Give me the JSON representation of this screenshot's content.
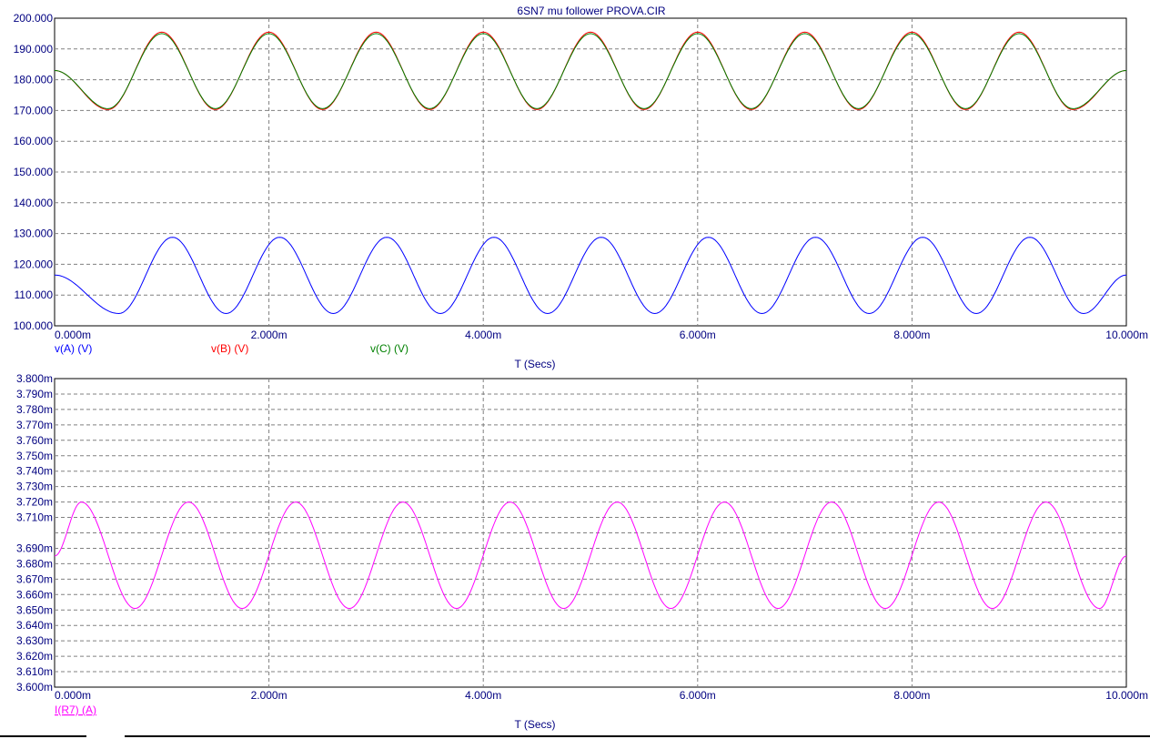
{
  "title": "6SN7  mu follower PROVA.CIR",
  "colors": {
    "frame": "#000000",
    "grid": "#808080",
    "axis_text": "#000080",
    "trace_A": "#0000ff",
    "trace_B": "#ff0000",
    "trace_C": "#008000",
    "trace_I": "#ff00ff"
  },
  "chart_data": [
    {
      "type": "line",
      "title": "6SN7  mu follower PROVA.CIR",
      "xlabel": "T (Secs)",
      "xlim": [
        0,
        10
      ],
      "x_unit": "ms",
      "x_ticks": [
        "0.000m",
        "2.000m",
        "4.000m",
        "6.000m",
        "8.000m",
        "10.000m"
      ],
      "ylim": [
        100,
        200
      ],
      "y_ticks": [
        "200.000",
        "190.000",
        "180.000",
        "170.000",
        "160.000",
        "150.000",
        "140.000",
        "130.000",
        "120.000",
        "110.000",
        "100.000"
      ],
      "grid": true,
      "series": [
        {
          "name": "v(A) (V)",
          "color": "#0000ff",
          "x": [
            0,
            0.6,
            1.1,
            1.6,
            2.1,
            2.6,
            3.1,
            3.6,
            4.1,
            4.6,
            5.1,
            5.6,
            6.1,
            6.6,
            7.1,
            7.6,
            8.1,
            8.6,
            9.1,
            9.6,
            10
          ],
          "values": [
            116.5,
            104,
            128.8,
            104,
            128.8,
            104,
            128.8,
            104,
            128.8,
            104,
            128.8,
            104,
            128.8,
            104,
            128.8,
            104,
            128.8,
            104,
            128.8,
            104,
            116.5
          ]
        },
        {
          "name": "v(B) (V)",
          "color": "#ff0000",
          "x": [
            0,
            0.5,
            1.0,
            1.5,
            2.0,
            2.5,
            3.0,
            3.5,
            4.0,
            4.5,
            5.0,
            5.5,
            6.0,
            6.5,
            7.0,
            7.5,
            8.0,
            8.5,
            9.0,
            9.5,
            10
          ],
          "values": [
            183,
            170.3,
            195.5,
            170.3,
            195.5,
            170.3,
            195.5,
            170.3,
            195.5,
            170.3,
            195.5,
            170.3,
            195.5,
            170.3,
            195.5,
            170.3,
            195.5,
            170.3,
            195.5,
            170.3,
            183
          ]
        },
        {
          "name": "v(C) (V)",
          "color": "#008000",
          "x": [
            0,
            0.5,
            1.0,
            1.5,
            2.0,
            2.5,
            3.0,
            3.5,
            4.0,
            4.5,
            5.0,
            5.5,
            6.0,
            6.5,
            7.0,
            7.5,
            8.0,
            8.5,
            9.0,
            9.5,
            10
          ],
          "values": [
            183,
            170.6,
            195.0,
            170.6,
            195.0,
            170.6,
            195.0,
            170.6,
            195.0,
            170.6,
            195.0,
            170.6,
            195.0,
            170.6,
            195.0,
            170.6,
            195.0,
            170.6,
            195.0,
            170.6,
            183
          ]
        }
      ]
    },
    {
      "type": "line",
      "xlabel": "T (Secs)",
      "xlim": [
        0,
        10
      ],
      "x_unit": "ms",
      "x_ticks": [
        "0.000m",
        "2.000m",
        "4.000m",
        "6.000m",
        "8.000m",
        "10.000m"
      ],
      "ylim": [
        3.6,
        3.8
      ],
      "y_ticks": [
        "3.800m",
        "3.790m",
        "3.780m",
        "3.770m",
        "3.760m",
        "3.750m",
        "3.740m",
        "3.730m",
        "3.720m",
        "3.710m",
        "",
        "3.690m",
        "3.680m",
        "3.670m",
        "3.660m",
        "3.650m",
        "3.640m",
        "3.630m",
        "3.620m",
        "3.610m",
        "3.600m"
      ],
      "grid": true,
      "series": [
        {
          "name": "I(R7) (A)",
          "color": "#ff00ff",
          "x": [
            0,
            0.25,
            0.75,
            1.25,
            1.75,
            2.25,
            2.75,
            3.25,
            3.75,
            4.25,
            4.75,
            5.25,
            5.75,
            6.25,
            6.75,
            7.25,
            7.75,
            8.25,
            8.75,
            9.25,
            9.75,
            10
          ],
          "values": [
            3.685,
            3.72,
            3.651,
            3.72,
            3.651,
            3.72,
            3.651,
            3.72,
            3.651,
            3.72,
            3.651,
            3.72,
            3.651,
            3.72,
            3.651,
            3.72,
            3.651,
            3.72,
            3.651,
            3.72,
            3.651,
            3.685
          ]
        }
      ]
    }
  ]
}
